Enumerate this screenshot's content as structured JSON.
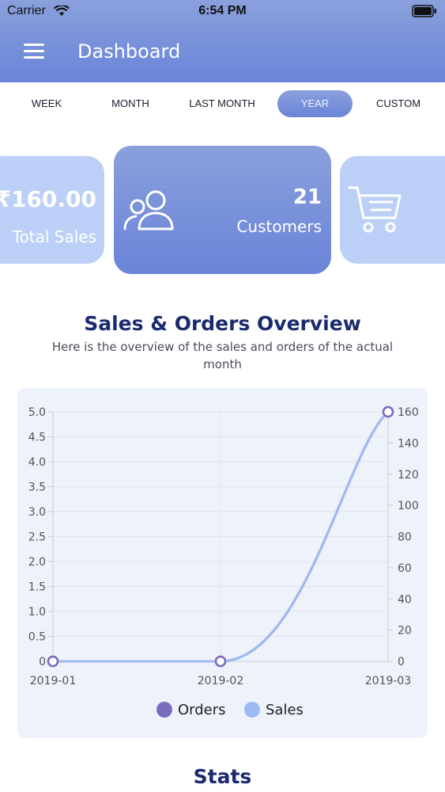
{
  "status_bar": {
    "carrier": "Carrier",
    "time": "6:54 PM"
  },
  "header": {
    "title": "Dashboard"
  },
  "tabs": [
    {
      "label": "WEEK",
      "active": false
    },
    {
      "label": "MONTH",
      "active": false
    },
    {
      "label": "LAST MONTH",
      "active": false
    },
    {
      "label": "YEAR",
      "active": true
    },
    {
      "label": "CUSTOM",
      "active": false
    }
  ],
  "cards": {
    "sales": {
      "value": "₹160.00",
      "label": "Total Sales"
    },
    "customers": {
      "value": "21",
      "label": "Customers"
    }
  },
  "overview": {
    "title": "Sales & Orders Overview",
    "subtitle": "Here is the overview of the sales and orders of the actual month"
  },
  "chart_data": {
    "type": "line",
    "x": [
      "2019-01",
      "2019-02",
      "2019-03"
    ],
    "series": [
      {
        "name": "Orders",
        "axis": "left",
        "values": [
          0,
          0,
          5
        ],
        "color": "#7a6bbf"
      },
      {
        "name": "Sales",
        "axis": "right",
        "values": [
          0,
          0,
          160
        ],
        "color": "#9fbaf2"
      }
    ],
    "y_left_ticks": [
      "0",
      "0.5",
      "1.0",
      "1.5",
      "2.0",
      "2.5",
      "3.0",
      "3.5",
      "4.0",
      "4.5",
      "5.0"
    ],
    "y_right_ticks": [
      "0",
      "20",
      "40",
      "60",
      "80",
      "100",
      "120",
      "140",
      "160"
    ],
    "ylim_left": [
      0,
      5
    ],
    "ylim_right": [
      0,
      160
    ],
    "legend_position": "bottom",
    "grid": true
  },
  "stats": {
    "title": "Stats"
  }
}
